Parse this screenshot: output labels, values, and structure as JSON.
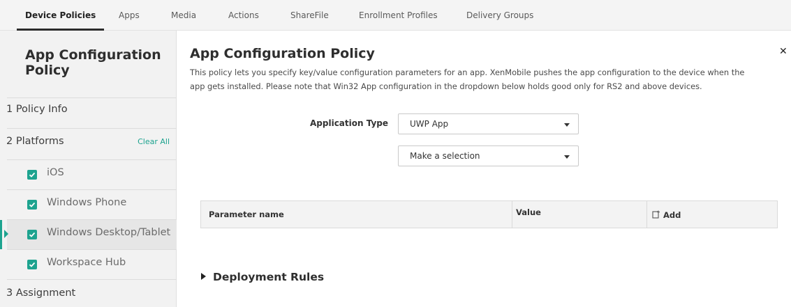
{
  "tabs": [
    {
      "label": "Device Policies",
      "active": true
    },
    {
      "label": "Apps"
    },
    {
      "label": "Media"
    },
    {
      "label": "Actions"
    },
    {
      "label": "ShareFile"
    },
    {
      "label": "Enrollment Profiles"
    },
    {
      "label": "Delivery Groups"
    }
  ],
  "sidebar": {
    "title": "App Configuration Policy",
    "step1": "1  Policy Info",
    "step2": "2  Platforms",
    "clear_all": "Clear All",
    "platforms": [
      {
        "label": "iOS",
        "checked": true
      },
      {
        "label": "Windows Phone",
        "checked": true
      },
      {
        "label": "Windows Desktop/Tablet",
        "checked": true,
        "selected": true
      },
      {
        "label": "Workspace Hub",
        "checked": true
      }
    ],
    "step3": "3  Assignment"
  },
  "main": {
    "title": "App Configuration Policy",
    "description": "This policy lets you specify key/value configuration parameters for an app. XenMobile pushes the app configuration to the device when the app gets installed. Please note that Win32 App configuration in the dropdown below holds good only for RS2 and above devices.",
    "application_type_label": "Application Type",
    "application_type_value": "UWP App",
    "app_select_value": "Make a selection",
    "table": {
      "col_param": "Parameter name",
      "col_value": "Value",
      "add_label": "Add"
    },
    "deployment_rules": "Deployment Rules"
  },
  "colors": {
    "accent": "#1da38f",
    "nav_bg": "#f4f4f4",
    "sidebar_bg": "#f2f2f2"
  },
  "icons": {
    "close": "close-icon",
    "checkbox": "checkbox-checked-icon",
    "add": "add-icon",
    "caret": "caret-down-icon"
  }
}
